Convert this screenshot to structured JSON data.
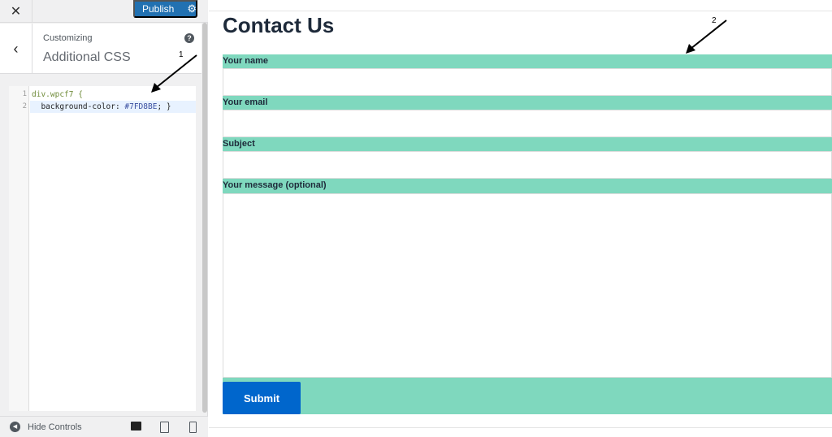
{
  "sidebar": {
    "close_icon": "close-icon",
    "publish_label": "Publish",
    "crumb": "Customizing",
    "title": "Additional CSS",
    "help_icon": "?",
    "code_lines": [
      {
        "n": "1",
        "text": "div.wpcf7 {"
      },
      {
        "n": "2",
        "prop": "  background-color: ",
        "value": "#7FD8BE",
        "end": "; }"
      }
    ],
    "hide_controls": "Hide Controls"
  },
  "annotations": [
    "1",
    "2"
  ],
  "preview": {
    "heading": "Contact Us",
    "fields": [
      "Your name",
      "Your email",
      "Subject",
      "Your message (optional)"
    ],
    "submit": "Submit"
  },
  "colors": {
    "form_bg": "#7FD8BE",
    "publish": "#2271b1",
    "submit": "#0066cc"
  }
}
